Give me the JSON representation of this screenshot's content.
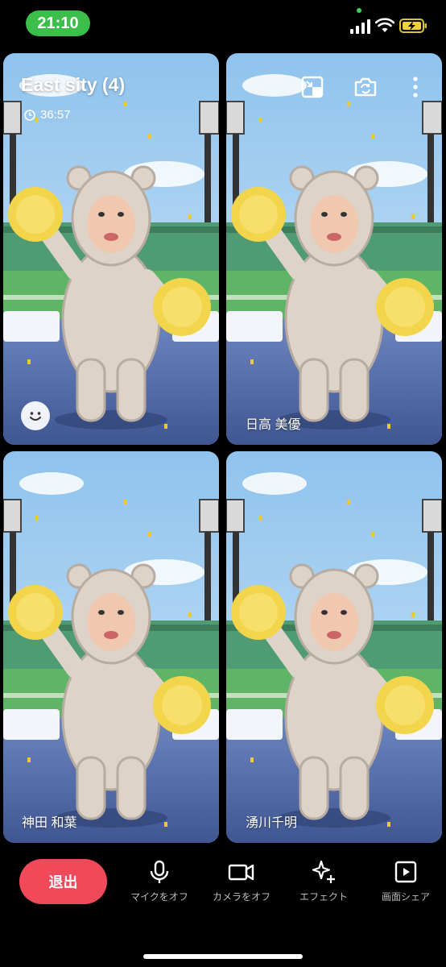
{
  "status_bar": {
    "time": "21:10",
    "icons": [
      "signal-icon",
      "wifi-icon",
      "battery-charging-icon"
    ]
  },
  "call": {
    "room_title": "East sity (4)",
    "elapsed": "36:57",
    "top_icons": [
      "minimize-icon",
      "switch-camera-icon",
      "more-vertical-icon"
    ]
  },
  "participants": [
    {
      "name": ""
    },
    {
      "name": "日高 美優"
    },
    {
      "name": "神田 和葉"
    },
    {
      "name": "湧川千明"
    }
  ],
  "toolbar": {
    "exit_label": "退出",
    "mic_label": "マイクをオフ",
    "camera_label": "カメラをオフ",
    "effect_label": "エフェクト",
    "screenshare_label": "画面シェア"
  },
  "colors": {
    "exit_button": "#f0495a",
    "time_pill": "#3bbf4a",
    "background": "#000000"
  }
}
